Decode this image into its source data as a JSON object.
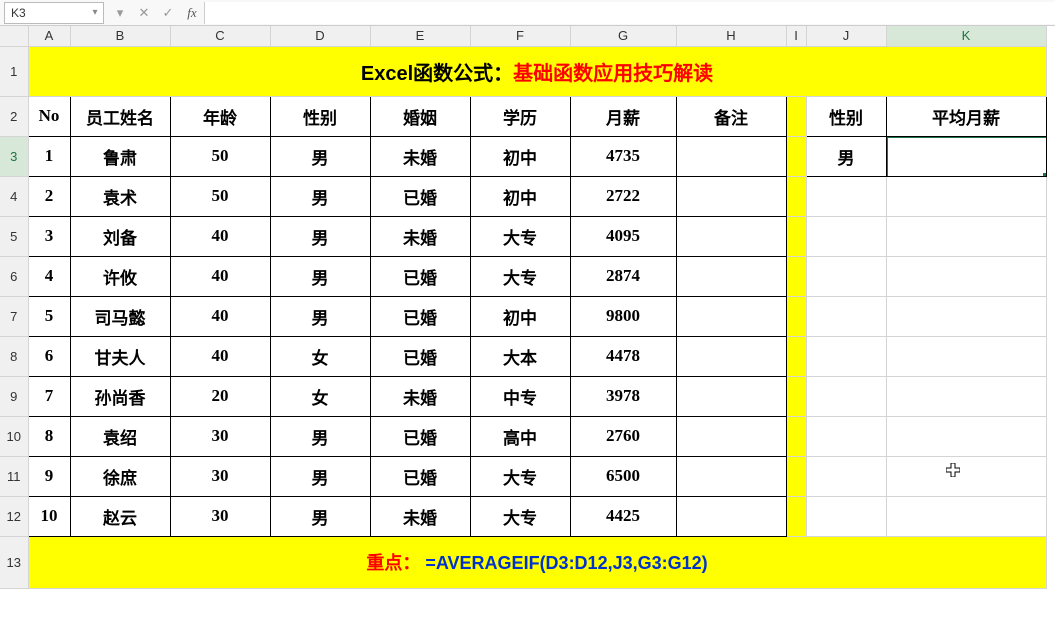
{
  "nameBox": "K3",
  "formula": "",
  "colHeaders": [
    "A",
    "B",
    "C",
    "D",
    "E",
    "F",
    "G",
    "H",
    "I",
    "J",
    "K"
  ],
  "rowHeaders": [
    "1",
    "2",
    "3",
    "4",
    "5",
    "6",
    "7",
    "8",
    "9",
    "10",
    "11",
    "12",
    "13"
  ],
  "title": {
    "black": "Excel函数公式：",
    "red": "基础函数应用技巧解读"
  },
  "headers": [
    "No",
    "员工姓名",
    "年龄",
    "性别",
    "婚姻",
    "学历",
    "月薪",
    "备注"
  ],
  "sideHeaders": [
    "性别",
    "平均月薪"
  ],
  "sideRow": {
    "j": "男",
    "k": ""
  },
  "rows": [
    {
      "no": "1",
      "name": "鲁肃",
      "age": "50",
      "sex": "男",
      "marry": "未婚",
      "edu": "初中",
      "salary": "4735",
      "note": ""
    },
    {
      "no": "2",
      "name": "袁术",
      "age": "50",
      "sex": "男",
      "marry": "已婚",
      "edu": "初中",
      "salary": "2722",
      "note": ""
    },
    {
      "no": "3",
      "name": "刘备",
      "age": "40",
      "sex": "男",
      "marry": "未婚",
      "edu": "大专",
      "salary": "4095",
      "note": ""
    },
    {
      "no": "4",
      "name": "许攸",
      "age": "40",
      "sex": "男",
      "marry": "已婚",
      "edu": "大专",
      "salary": "2874",
      "note": ""
    },
    {
      "no": "5",
      "name": "司马懿",
      "age": "40",
      "sex": "男",
      "marry": "已婚",
      "edu": "初中",
      "salary": "9800",
      "note": ""
    },
    {
      "no": "6",
      "name": "甘夫人",
      "age": "40",
      "sex": "女",
      "marry": "已婚",
      "edu": "大本",
      "salary": "4478",
      "note": ""
    },
    {
      "no": "7",
      "name": "孙尚香",
      "age": "20",
      "sex": "女",
      "marry": "未婚",
      "edu": "中专",
      "salary": "3978",
      "note": ""
    },
    {
      "no": "8",
      "name": "袁绍",
      "age": "30",
      "sex": "男",
      "marry": "已婚",
      "edu": "高中",
      "salary": "2760",
      "note": ""
    },
    {
      "no": "9",
      "name": "徐庶",
      "age": "30",
      "sex": "男",
      "marry": "已婚",
      "edu": "大专",
      "salary": "6500",
      "note": ""
    },
    {
      "no": "10",
      "name": "赵云",
      "age": "30",
      "sex": "男",
      "marry": "未婚",
      "edu": "大专",
      "salary": "4425",
      "note": ""
    }
  ],
  "footer": {
    "label": "重点：",
    "formula": "=AVERAGEIF(D3:D12,J3,G3:G12)"
  },
  "selectedCell": "K3",
  "icons": {
    "dropdown": "▾",
    "expand": "▾",
    "cancel": "✕",
    "enter": "✓",
    "fx": "fx"
  }
}
